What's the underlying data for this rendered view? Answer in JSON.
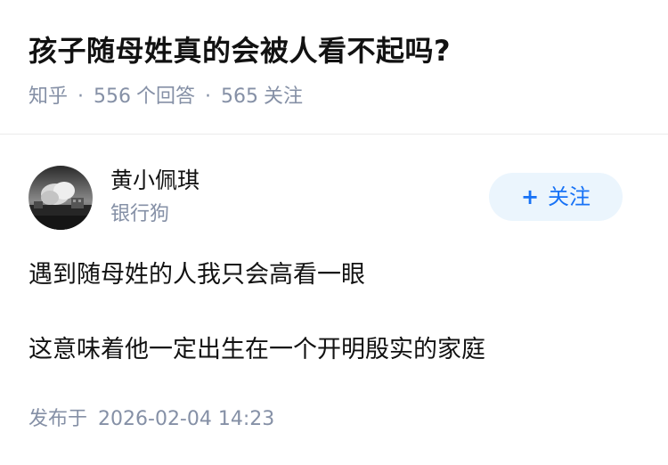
{
  "question": {
    "title": "孩子随母姓真的会被人看不起吗?",
    "source": "知乎",
    "answer_count": "556",
    "answer_label": "个回答",
    "follower_count": "565",
    "follower_label": "关注",
    "separator": "·"
  },
  "answer": {
    "author": {
      "name": "黄小佩琪",
      "bio": "银行狗",
      "avatar_icon": "avatar-photo-icon"
    },
    "follow_button": {
      "icon": "plus-icon",
      "plus_glyph": "+",
      "label": "关注"
    },
    "paragraphs": [
      "遇到随母姓的人我只会高看一眼",
      "这意味着他一定出生在一个开明殷实的家庭"
    ],
    "publish": {
      "label": "发布于",
      "datetime": "2026-02-04 14:23"
    }
  },
  "colors": {
    "title": "#121212",
    "meta": "#8590a6",
    "accent": "#1772f6",
    "follow_bg": "#ebf5fd",
    "divider": "#ebebeb"
  }
}
